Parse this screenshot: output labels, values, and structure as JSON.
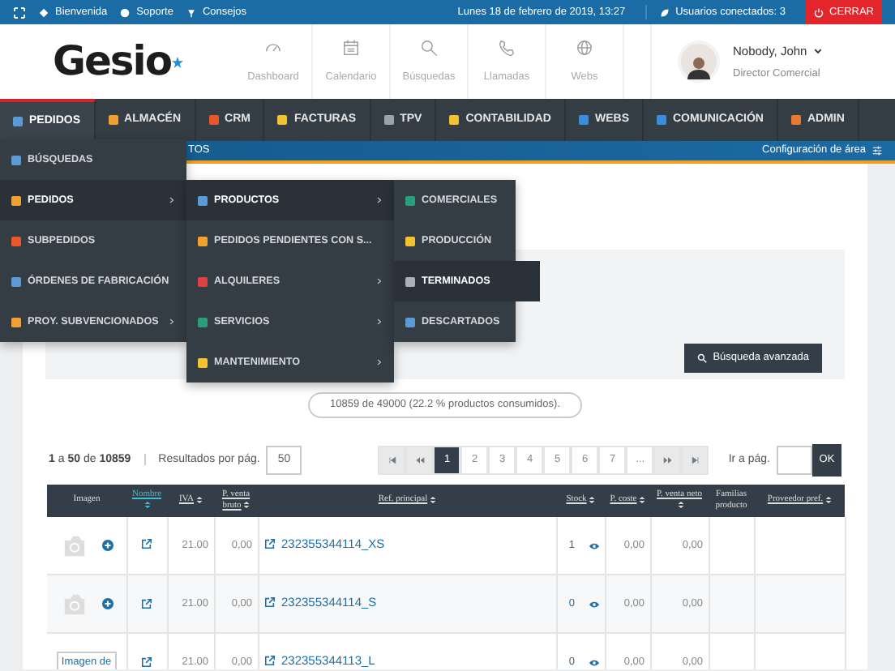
{
  "top_bar": {
    "links": [
      {
        "label": "Bienvenida"
      },
      {
        "label": "Soporte"
      },
      {
        "label": "Consejos"
      }
    ],
    "date": "Lunes 18 de febrero de 2019, 13:27",
    "users": "Usuarios conectados: 3",
    "close_button": "CERRAR"
  },
  "header": {
    "logo": "Gesio",
    "quick_links": [
      {
        "label": "Dashboard"
      },
      {
        "label": "Calendario"
      },
      {
        "label": "Búsquedas"
      },
      {
        "label": "Llamadas"
      },
      {
        "label": "Webs"
      }
    ],
    "user": {
      "name": "Nobody, John",
      "role": "Director Comercial"
    }
  },
  "main_nav": [
    {
      "label": "PEDIDOS",
      "selected": true
    },
    {
      "label": "ALMACÉN",
      "selected": false
    },
    {
      "label": "CRM",
      "selected": false
    },
    {
      "label": "FACTURAS",
      "selected": false
    },
    {
      "label": "TPV",
      "selected": false
    },
    {
      "label": "CONTABILIDAD",
      "selected": false
    },
    {
      "label": "WEBS",
      "selected": false
    },
    {
      "label": "COMUNICACIÓN",
      "selected": false
    },
    {
      "label": "ADMIN",
      "selected": false
    }
  ],
  "sub_bar": {
    "title": "TOS",
    "config": "Configuración de área"
  },
  "menu": [
    {
      "label": "BÚSQUEDAS",
      "selected": false,
      "submenu": false
    },
    {
      "label": "PEDIDOS",
      "selected": true,
      "submenu": true,
      "children": [
        {
          "label": "PRODUCTOS",
          "selected": true,
          "submenu": true,
          "children": [
            {
              "label": "COMERCIALES",
              "selected": false,
              "submenu": false
            },
            {
              "label": "PRODUCCIÓN",
              "selected": false,
              "submenu": false
            },
            {
              "label": "TERMINADOS",
              "selected": true,
              "submenu": false
            },
            {
              "label": "DESCARTADOS",
              "selected": false,
              "submenu": false
            }
          ]
        },
        {
          "label": "PEDIDOS PENDIENTES CON S...",
          "selected": false,
          "submenu": false
        },
        {
          "label": "ALQUILERES",
          "selected": false,
          "submenu": true
        },
        {
          "label": "SERVICIOS",
          "selected": false,
          "submenu": true
        },
        {
          "label": "MANTENIMIENTO",
          "selected": false,
          "submenu": true
        }
      ]
    },
    {
      "label": "SUBPEDIDOS",
      "selected": false,
      "submenu": false
    },
    {
      "label": "ÓRDENES DE FABRICACIÓN",
      "selected": false,
      "submenu": false
    },
    {
      "label": "PROY. SUBVENCIONADOS",
      "selected": false,
      "submenu": true
    }
  ],
  "search_panel": {
    "advanced_button": "Búsqueda avanzada"
  },
  "usage": "10859 de 49000 (22.2 % productos consumidos).",
  "pagination": {
    "range": "**1** a **50** de **10859**",
    "per_page_label": "Resultados por pág.",
    "per_page": "50",
    "pages": [
      {
        "kind": "first"
      },
      {
        "kind": "prev"
      },
      {
        "kind": "page",
        "label": "1",
        "selected": true
      },
      {
        "kind": "page",
        "label": "2",
        "selected": false
      },
      {
        "kind": "page",
        "label": "3",
        "selected": false
      },
      {
        "kind": "page",
        "label": "4",
        "selected": false
      },
      {
        "kind": "page",
        "label": "5",
        "selected": false
      },
      {
        "kind": "page",
        "label": "6",
        "selected": false
      },
      {
        "kind": "page",
        "label": "7",
        "selected": false
      },
      {
        "kind": "page",
        "label": "...",
        "selected": false
      },
      {
        "kind": "next"
      },
      {
        "kind": "last"
      }
    ],
    "goto_label": "Ir a pág.",
    "ok": "OK"
  },
  "table": {
    "columns": [
      {
        "label": "Imagen",
        "sortable": false,
        "selected": false
      },
      {
        "label": "Nombre",
        "sortable": true,
        "selected": true
      },
      {
        "label": "IVA",
        "sortable": true,
        "selected": false
      },
      {
        "label": "P. venta bruto",
        "sortable": true,
        "selected": false
      },
      {
        "label": "Ref. principal",
        "sortable": true,
        "selected": false
      },
      {
        "label": "Stock",
        "sortable": true,
        "selected": false
      },
      {
        "label": "P. coste",
        "sortable": true,
        "selected": false
      },
      {
        "label": "P. venta neto",
        "sortable": true,
        "selected": false
      },
      {
        "label": "Familias producto",
        "sortable": false,
        "selected": false
      },
      {
        "label": "Proveedor pref.",
        "sortable": true,
        "selected": false
      }
    ],
    "rows": [
      {
        "kind": "photo",
        "iva": "21.00",
        "bruto": "0,00",
        "ref": "232355344114_XS",
        "stock": "1",
        "coste": "0,00",
        "neto": "0,00"
      },
      {
        "kind": "photo",
        "iva": "21.00",
        "bruto": "0,00",
        "ref": "232355344114_S",
        "stock": "0",
        "coste": "0,00",
        "neto": "0,00"
      },
      {
        "kind": "alt",
        "image_alt": "Imagen de",
        "iva": "21.00",
        "bruto": "0,00",
        "ref": "232355344113_L",
        "stock": "0",
        "coste": "0,00",
        "neto": "0,00"
      }
    ]
  }
}
